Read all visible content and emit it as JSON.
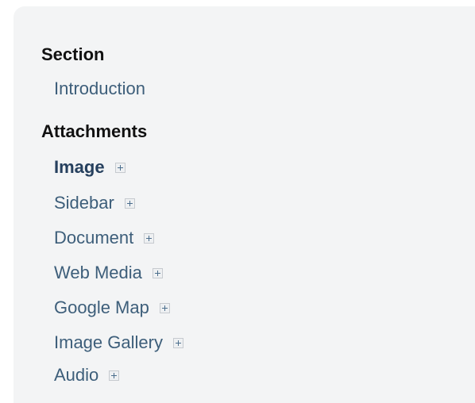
{
  "nav": {
    "section_heading": "Section",
    "section_items": [
      {
        "label": "Introduction"
      }
    ],
    "attachments_heading": "Attachments",
    "attachment_items": [
      {
        "label": "Image",
        "active": true,
        "icon": "plus-icon"
      },
      {
        "label": "Sidebar",
        "icon": "plus-icon"
      },
      {
        "label": "Document",
        "icon": "plus-icon"
      },
      {
        "label": "Web Media",
        "icon": "plus-icon"
      },
      {
        "label": "Google Map",
        "icon": "plus-icon"
      },
      {
        "label": "Image Gallery",
        "icon": "plus-icon"
      },
      {
        "label": "Audio",
        "icon": "plus-icon"
      }
    ]
  },
  "colors": {
    "panel_background": "#f3f4f5",
    "link": "#3d5e7a",
    "active_link": "#26405e",
    "heading": "#111111"
  }
}
